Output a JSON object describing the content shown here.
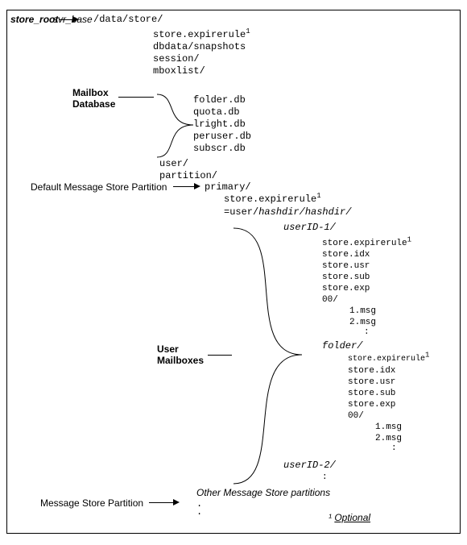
{
  "header": {
    "store_root": "store_root",
    "arrow_label": "svr_base",
    "path": "/data/store/"
  },
  "top_tree": {
    "line1": "store.expirerule",
    "line2": "dbdata/snapshots",
    "line3": "session/",
    "line4": "mboxlist/",
    "db1": "folder.db",
    "db2": "quota.db",
    "db3": "lright.db",
    "db4": "peruser.db",
    "db5": "subscr.db",
    "user": "user/",
    "partition": "partition/",
    "primary": "primary/",
    "primary_rule": "store.expirerule",
    "userhash": "=user/",
    "hashdir": "hashdir/hashdir/"
  },
  "labels": {
    "mailbox_db_1": "Mailbox",
    "mailbox_db_2": "Database",
    "default_ms_part": "Default Message Store Partition",
    "user_mb_1": "User",
    "user_mb_2": "Mailboxes",
    "ms_part": "Message Store Partition",
    "other_parts": "Other Message Store partitions",
    "optional_mark": "¹",
    "optional": "Optional",
    "dots": ".",
    "sup1": "1"
  },
  "user_tree": {
    "userid1": "userID-1/",
    "rule": "store.expirerule",
    "idx": "store.idx",
    "usr": "store.usr",
    "sub": "store.sub",
    "exp": "store.exp",
    "zero": "00/",
    "msg1": "1.msg",
    "msg2": "2.msg",
    "vdots": ":",
    "folder": "folder/",
    "f_rule": "store.expirerule",
    "f_idx": "store.idx",
    "f_usr": "store.usr",
    "f_sub": "store.sub",
    "f_exp": "store.exp",
    "f_zero": "00/",
    "f_msg1": "1.msg",
    "f_msg2": "2.msg",
    "userid2": "userID-2/"
  }
}
